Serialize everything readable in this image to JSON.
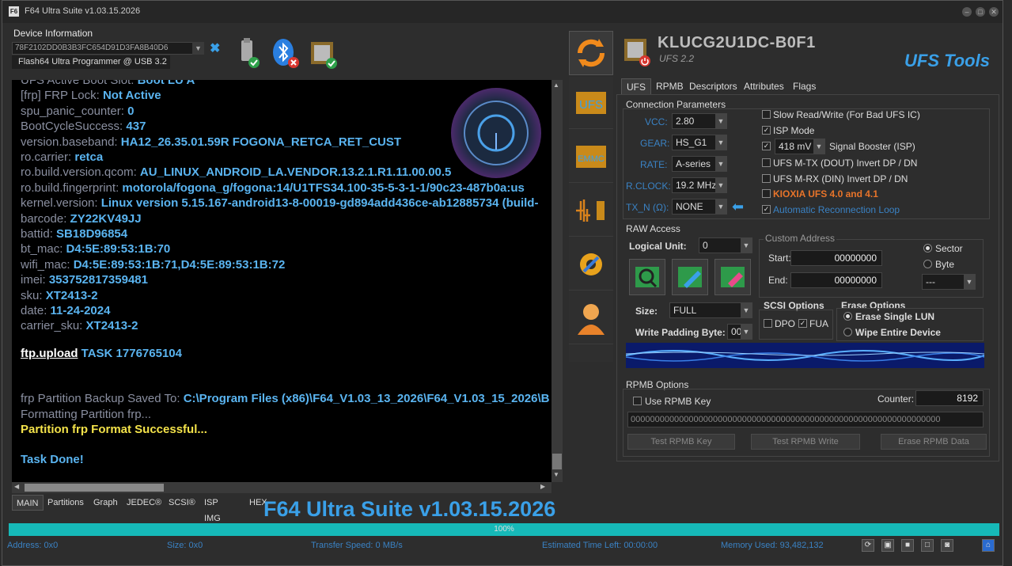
{
  "window": {
    "title": "F64 Ultra Suite v1.03.15.2026",
    "icon_label": "F6",
    "min": "–",
    "max": "□",
    "close": "✕"
  },
  "device_info": {
    "label": "Device Information",
    "serial": "78F2102DD0B3B3FC654D91D3FA8B40D6",
    "status": "Flash64 Ultra Programmer @ USB 3.2",
    "disconnect_icon": "✖"
  },
  "console": {
    "lines": [
      {
        "k": "UFS Active Boot Slot:",
        "v": "Boot LU A",
        "style": "kv"
      },
      {
        "k": "[frp] FRP Lock:",
        "v": "Not Active",
        "style": "kv"
      },
      {
        "k": "spu_panic_counter:",
        "v": "0",
        "style": "kv"
      },
      {
        "k": "BootCycleSuccess:",
        "v": "437",
        "style": "kv"
      },
      {
        "k": "version.baseband:",
        "v": "HA12_26.35.01.59R FOGONA_RETCA_RET_CUST",
        "style": "kv"
      },
      {
        "k": "ro.carrier:",
        "v": "retca",
        "style": "kv"
      },
      {
        "k": "ro.build.version.qcom:",
        "v": "AU_LINUX_ANDROID_LA.VENDOR.13.2.1.R1.11.00.00.5",
        "style": "kv"
      },
      {
        "k": "ro.build.fingerprint:",
        "v": "motorola/fogona_g/fogona:14/U1TFS34.100-35-5-3-1-1/90c23-487b0a:us",
        "style": "kv"
      },
      {
        "k": "kernel.version:",
        "v": "Linux version 5.15.167-android13-8-00019-gd894add436ce-ab12885734 (build-",
        "style": "kv"
      },
      {
        "k": "barcode:",
        "v": "ZY22KV49JJ",
        "style": "kv"
      },
      {
        "k": "battid:",
        "v": "SB18D96854",
        "style": "kv"
      },
      {
        "k": "bt_mac:",
        "v": "D4:5E:89:53:1B:70",
        "style": "kv"
      },
      {
        "k": "wifi_mac:",
        "v": "D4:5E:89:53:1B:71,D4:5E:89:53:1B:72",
        "style": "kv"
      },
      {
        "k": "imei:",
        "v": "353752817359481",
        "style": "kv"
      },
      {
        "k": "sku:",
        "v": "XT2413-2",
        "style": "kv"
      },
      {
        "k": "date:",
        "v": "11-24-2024",
        "style": "kv"
      },
      {
        "k": "carrier_sku:",
        "v": "XT2413-2",
        "style": "kv"
      }
    ],
    "ftp_label": "ftp.upload",
    "ftp_task": "TASK 1776765104",
    "backup_label": "frp Partition Backup Saved To:",
    "backup_path": "C:\\Program Files (x86)\\F64_V1.03_13_2026\\F64_V1.03_15_2026\\B",
    "formatting": "Formatting Partition frp...",
    "format_success": "Partition frp Format Successful...",
    "task_done": "Task Done!"
  },
  "bottom_tabs": [
    "MAIN",
    "Partitions",
    "Graph",
    "JEDEC®",
    "SCSI®",
    "ISP IMG",
    "HEX"
  ],
  "brand": "F64 Ultra Suite v1.03.15.2026",
  "progress": {
    "value": 1.0,
    "label": "100%"
  },
  "status": {
    "address": "Address: 0x0",
    "size": "Size: 0x0",
    "speed": "Transfer Speed: 0 MB/s",
    "eta": "Estimated Time Left: 00:00:00",
    "memory": "Memory Used: 93,482,132"
  },
  "status_buttons": [
    "⟳",
    "▣",
    "■",
    "□",
    "◙",
    "⌂"
  ],
  "sidebar": [
    "UFS",
    "EMMC",
    "WAVE",
    "SETTINGS",
    "USER"
  ],
  "device": {
    "model": "KLUCG2U1DC-B0F1",
    "sub": "UFS 2.2",
    "tool": "UFS Tools"
  },
  "right_tabs": [
    "UFS",
    "RPMB",
    "Descriptors",
    "Attributes",
    "Flags"
  ],
  "connection": {
    "title": "Connection Parameters",
    "vcc_label": "VCC:",
    "vcc": "2.80",
    "gear_label": "GEAR:",
    "gear": "HS_G1",
    "rate_label": "RATE:",
    "rate": "A-series",
    "rclock_label": "R.CLOCK:",
    "rclock": "19.2 MHz",
    "txn_label": "TX_N (Ω):",
    "txn": "NONE",
    "slow_rw": "Slow Read/Write (For Bad UFS IC)",
    "isp_mode": "ISP Mode",
    "booster_value": "418 mV",
    "booster_label": "Signal Booster (ISP)",
    "mtx": "UFS M-TX (DOUT) Invert DP / DN",
    "mrx": "UFS M-RX (DIN) Invert DP / DN",
    "kioxia": "KIOXIA UFS 4.0 and 4.1",
    "auto_reconnect": "Automatic Reconnection Loop",
    "check_mark": "✓"
  },
  "raw": {
    "title": "RAW Access",
    "lu_label": "Logical Unit:",
    "lu": "0",
    "custom_title": "Custom Address",
    "start_label": "Start:",
    "start": "00000000",
    "end_label": "End:",
    "end": "00000000",
    "sector": "Sector",
    "byte": "Byte",
    "unit_select": "---",
    "size_label": "Size:",
    "size": "FULL",
    "padding_label": "Write Padding Byte:",
    "padding": "00",
    "scsi_title": "SCSI Options",
    "dpo": "DPO",
    "fua": "FUA",
    "erase_title": "Erase Options",
    "erase_single": "Erase Single LUN",
    "wipe": "Wipe Entire Device"
  },
  "rpmb": {
    "title": "RPMB Options",
    "use_key": "Use RPMB Key",
    "counter_label": "Counter:",
    "counter": "8192",
    "key": "0000000000000000000000000000000000000000000000000000000000000000",
    "test_key": "Test RPMB Key",
    "test_write": "Test RPMB Write",
    "erase": "Erase RPMB Data"
  },
  "colors": {
    "accent": "#3aa0e8",
    "progress": "#16b9b8",
    "kioxia": "#e8742a"
  }
}
